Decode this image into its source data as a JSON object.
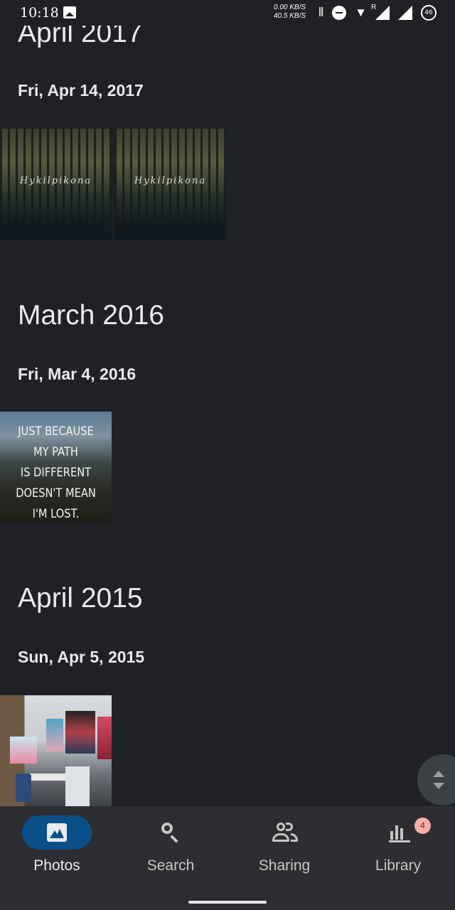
{
  "status_bar": {
    "time": "10:18",
    "net_up": "0.00 KB/S",
    "net_down": "40.5 KB/S",
    "battery_level": "46",
    "signal_roaming": "R",
    "icons": [
      "gallery-icon",
      "vibrate-icon",
      "do-not-disturb-icon",
      "wifi-icon",
      "signal-icon",
      "signal-icon",
      "battery-icon"
    ]
  },
  "timeline": [
    {
      "month": "April 2017",
      "day": "Fri, Apr 14, 2017",
      "photos": [
        {
          "kind": "forest",
          "overlay_text": "Hykilpikona"
        },
        {
          "kind": "forest",
          "overlay_text": "Hykilpikona"
        }
      ]
    },
    {
      "month": "March 2016",
      "day": "Fri, Mar 4, 2016",
      "photos": [
        {
          "kind": "quote",
          "overlay_lines": [
            "JUST BECAUSE",
            "MY PATH",
            "IS DIFFERENT",
            "DOESN'T MEAN",
            "I'M LOST."
          ]
        }
      ]
    },
    {
      "month": "April 2015",
      "day": "Sun, Apr 5, 2015",
      "photos": [
        {
          "kind": "room"
        }
      ]
    }
  ],
  "bottom_nav": {
    "items": [
      {
        "label": "Photos",
        "icon": "photos-icon",
        "active": true
      },
      {
        "label": "Search",
        "icon": "search-icon",
        "active": false
      },
      {
        "label": "Sharing",
        "icon": "sharing-icon",
        "active": false
      },
      {
        "label": "Library",
        "icon": "library-icon",
        "active": false,
        "badge": "4"
      }
    ]
  },
  "colors": {
    "background": "#202124",
    "nav_background": "#2d2e31",
    "active_pill": "#0b4f8a",
    "badge": "#f6aea9"
  }
}
